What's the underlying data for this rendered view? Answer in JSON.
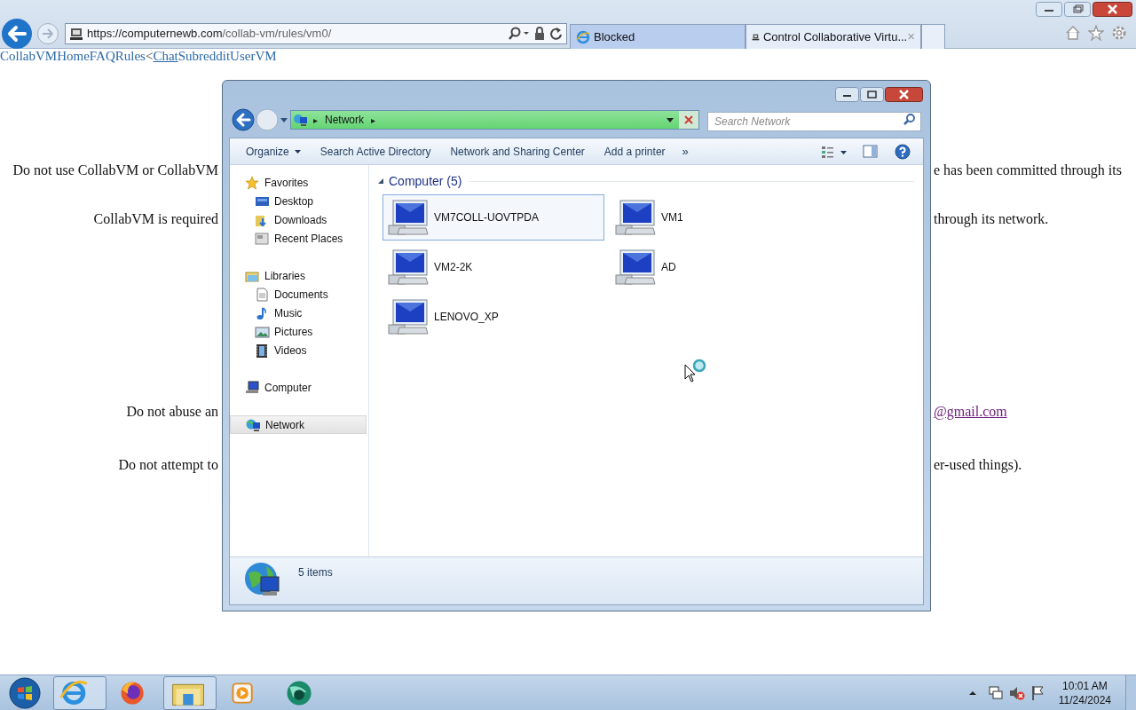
{
  "browser": {
    "url": {
      "host": "https://computernewb.com",
      "path": "/collab-vm/rules/vm0/"
    },
    "tabs": [
      {
        "label": "Blocked",
        "selected": false
      },
      {
        "label": "Control Collaborative Virtu...",
        "selected": true,
        "close": "×"
      }
    ]
  },
  "page": {
    "nav_links": [
      {
        "text": "CollabVM",
        "kind": "link",
        "hovered": false
      },
      {
        "text": "Home",
        "kind": "link",
        "hovered": false
      },
      {
        "text": "FAQ",
        "kind": "link",
        "hovered": false
      },
      {
        "text": "Rules",
        "kind": "link",
        "hovered": false
      },
      {
        "text": "<",
        "kind": "text",
        "hovered": false
      },
      {
        "text": "Chat",
        "kind": "link",
        "hovered": true
      },
      {
        "text": "Subreddit",
        "kind": "link",
        "hovered": false
      },
      {
        "text": "UserVM",
        "kind": "link",
        "hovered": false
      }
    ],
    "paragraphs": [
      {
        "left": "Do not use CollabVM or CollabVM",
        "right": "e has been committed through its"
      },
      {
        "left": "CollabVM is required",
        "right": "through its network."
      },
      {
        "left": "Do not abuse an",
        "right_link": "@gmail.com"
      },
      {
        "left": "Do not attempt to",
        "right": "er-used things)."
      }
    ]
  },
  "explorer": {
    "address": {
      "crumb": "Network",
      "sep": "▸"
    },
    "search": {
      "placeholder": "Search Network"
    },
    "toolbar": [
      {
        "label": "Organize",
        "dropdown": true
      },
      {
        "label": "Search Active Directory",
        "dropdown": false
      },
      {
        "label": "Network and Sharing Center",
        "dropdown": false
      },
      {
        "label": "Add a printer",
        "dropdown": false
      }
    ],
    "more": "»",
    "nav": [
      {
        "label": "Favorites",
        "selected": false,
        "children": [
          {
            "label": "Desktop",
            "selected": false
          },
          {
            "label": "Downloads",
            "selected": false
          },
          {
            "label": "Recent Places",
            "selected": false
          }
        ]
      },
      {
        "label": "Libraries",
        "selected": false,
        "children": [
          {
            "label": "Documents",
            "selected": false
          },
          {
            "label": "Music",
            "selected": false
          },
          {
            "label": "Pictures",
            "selected": false
          },
          {
            "label": "Videos",
            "selected": false
          }
        ]
      },
      {
        "label": "Computer",
        "selected": false
      },
      {
        "label": "Network",
        "selected": true
      }
    ],
    "group": "Computer (5)",
    "items": [
      {
        "label": "VM7COLL-UOVTPDA",
        "selected": true
      },
      {
        "label": "VM1",
        "selected": false
      },
      {
        "label": "VM2-2K",
        "selected": false
      },
      {
        "label": "AD",
        "selected": false
      },
      {
        "label": "LENOVO_XP",
        "selected": false
      }
    ],
    "status": "5 items"
  },
  "taskbar": {
    "apps": [
      {
        "kind": "ie",
        "active": true
      },
      {
        "kind": "firefox",
        "active": false
      },
      {
        "kind": "explorer",
        "active": true
      },
      {
        "kind": "media",
        "active": false
      },
      {
        "kind": "chat",
        "active": false
      }
    ],
    "time": "10:01 AM",
    "date": "11/24/2024"
  }
}
